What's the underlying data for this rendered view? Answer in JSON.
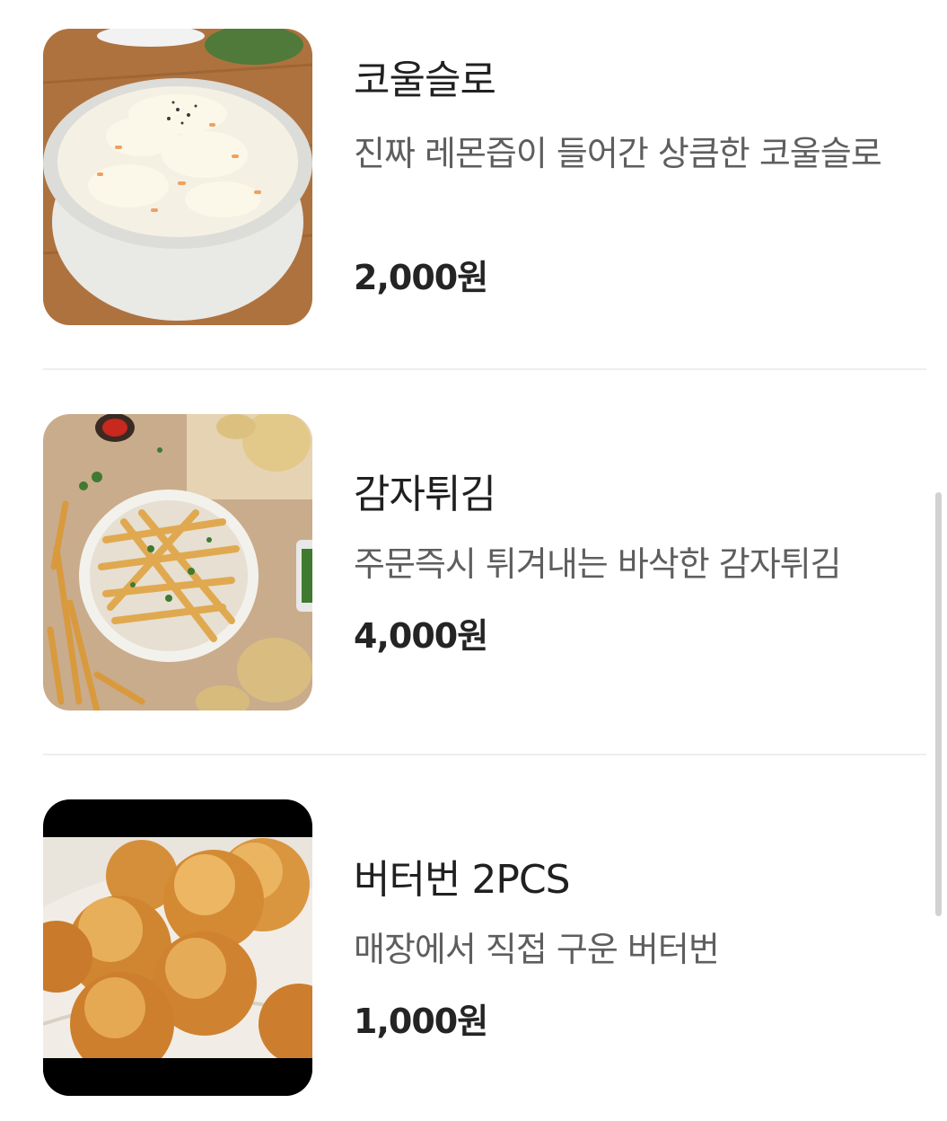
{
  "menu": {
    "items": [
      {
        "name": "코울슬로",
        "description": "진짜 레몬즙이 들어간 상큼한 코울슬로",
        "price": "2,000원",
        "image_icon": "coleslaw-photo"
      },
      {
        "name": "감자튀김",
        "description": "주문즉시 튀겨내는 바삭한 감자튀김",
        "price": "4,000원",
        "image_icon": "french-fries-photo"
      },
      {
        "name": "버터번 2PCS",
        "description": "매장에서 직접 구운 버터번",
        "price": "1,000원",
        "image_icon": "butter-bun-photo"
      }
    ]
  },
  "colors": {
    "title": "#202020",
    "description": "#5e5e5e",
    "price": "#242424",
    "divider": "#eeeeee",
    "scrollbar": "#d2d2d2"
  }
}
